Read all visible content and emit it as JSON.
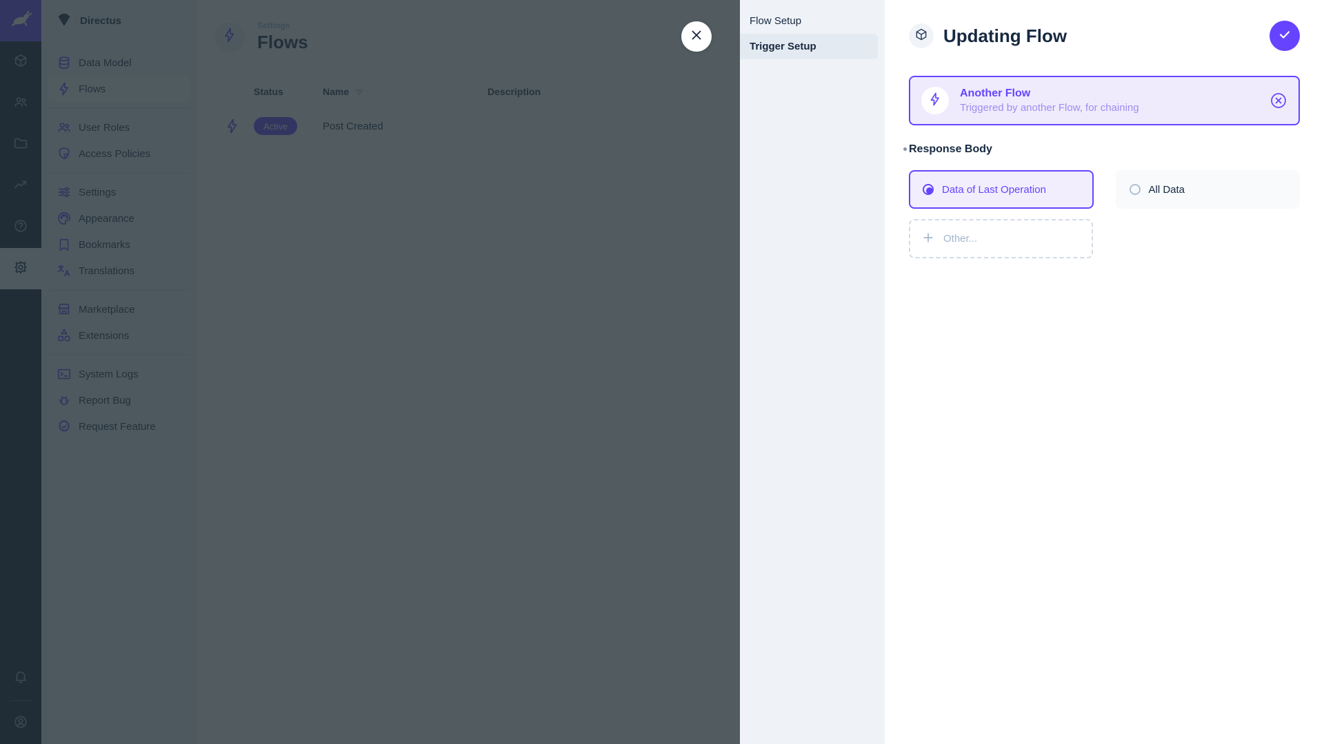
{
  "colors": {
    "primary": "#6644ff",
    "module_bar_bg": "#0e1c2f",
    "nav_bg": "#f0f4f9",
    "overlay": "rgba(38,50,56,0.8)",
    "text_dark": "#172940",
    "text_subdued": "#a2b5cd"
  },
  "project": {
    "name": "Directus"
  },
  "module_bar": {
    "modules": [
      {
        "icon": "box-icon"
      },
      {
        "icon": "people-icon"
      },
      {
        "icon": "folder-icon"
      },
      {
        "icon": "monitoring-icon"
      },
      {
        "icon": "help-icon"
      },
      {
        "icon": "gear-icon",
        "active": true
      }
    ],
    "bottom": [
      {
        "icon": "bell-icon"
      },
      {
        "icon": "account-circle-icon"
      }
    ]
  },
  "nav": {
    "groups": [
      {
        "items": [
          {
            "label": "Data Model",
            "icon": "database-icon"
          },
          {
            "label": "Flows",
            "icon": "bolt-icon",
            "active": true
          }
        ]
      },
      {
        "items": [
          {
            "label": "User Roles",
            "icon": "users-icon"
          },
          {
            "label": "Access Policies",
            "icon": "shield-icon"
          }
        ]
      },
      {
        "items": [
          {
            "label": "Settings",
            "icon": "tune-icon"
          },
          {
            "label": "Appearance",
            "icon": "palette-icon"
          },
          {
            "label": "Bookmarks",
            "icon": "bookmark-icon"
          },
          {
            "label": "Translations",
            "icon": "translate-icon"
          }
        ]
      },
      {
        "items": [
          {
            "label": "Marketplace",
            "icon": "storefront-icon"
          },
          {
            "label": "Extensions",
            "icon": "category-icon"
          }
        ]
      },
      {
        "items": [
          {
            "label": "System Logs",
            "icon": "terminal-icon"
          },
          {
            "label": "Report Bug",
            "icon": "bug-icon"
          },
          {
            "label": "Request Feature",
            "icon": "feature-icon"
          }
        ]
      }
    ]
  },
  "main": {
    "breadcrumb": "Settings",
    "title": "Flows",
    "table": {
      "columns": {
        "status": "Status",
        "name": "Name",
        "description": "Description"
      },
      "rows": [
        {
          "status": "Active",
          "name": "Post Created",
          "description": ""
        }
      ]
    }
  },
  "drawer": {
    "nav": [
      {
        "label": "Flow Setup",
        "active": false
      },
      {
        "label": "Trigger Setup",
        "active": true
      }
    ],
    "title": "Updating Flow",
    "trigger_card": {
      "title": "Another Flow",
      "subtitle": "Triggered by another Flow, for chaining"
    },
    "response_body": {
      "label": "Response Body",
      "options": [
        {
          "label": "Data of Last Operation",
          "selected": true
        },
        {
          "label": "All Data",
          "selected": false
        }
      ],
      "other_label": "Other..."
    }
  }
}
